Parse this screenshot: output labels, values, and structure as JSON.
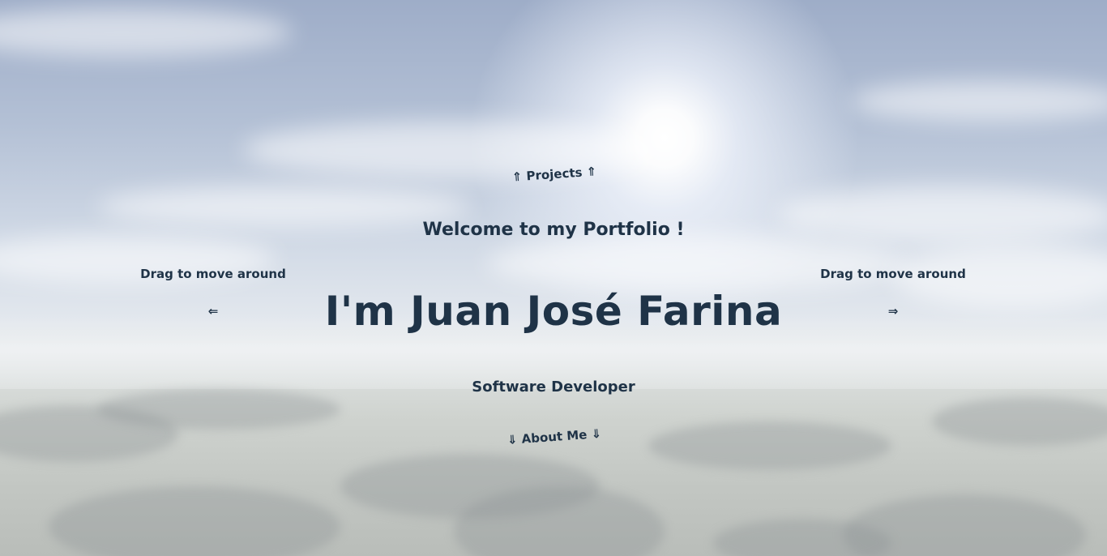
{
  "nav": {
    "projects_label": "⇑ Projects ⇑",
    "about_label": "⇓ About Me ⇓"
  },
  "hero": {
    "welcome": "Welcome to my Portfolio !",
    "name": "I'm Juan José Farina",
    "role": "Software Developer"
  },
  "hints": {
    "left_text": "Drag to move around",
    "right_text": "Drag to move around",
    "left_arrow": "⇐",
    "right_arrow": "⇒"
  },
  "theme": {
    "text_color": "#1f3347",
    "sky_top": "#9eadc8",
    "sky_horizon": "#e3e8ee",
    "ground": "#c2c6c2"
  }
}
